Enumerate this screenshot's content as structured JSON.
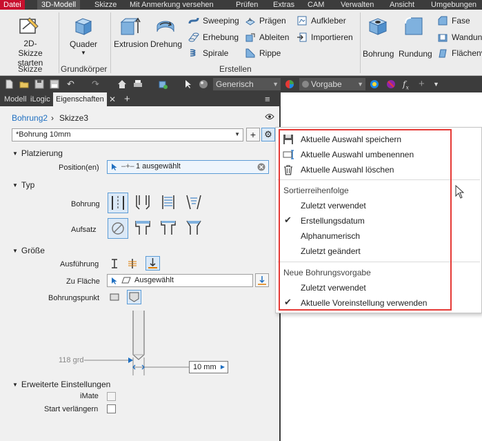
{
  "ribbon_tabs": [
    "Datei",
    "3D-Modell",
    "Skizze",
    "Mit Anmerkung versehen",
    "Prüfen",
    "Extras",
    "CAM",
    "Verwalten",
    "Ansicht",
    "Umgebungen"
  ],
  "ribbon": {
    "sketch_button": "2D-Skizze\nstarten",
    "sketch_group": "Skizze",
    "box_button": "Quader",
    "primitives_group": "Grundkörper",
    "extrude": "Extrusion",
    "revolve": "Drehung",
    "sweep": "Sweeping",
    "loft": "Erhebung",
    "coil": "Spirale",
    "emboss": "Prägen",
    "derive": "Ableiten",
    "rib": "Rippe",
    "decal": "Aufkleber",
    "import": "Importieren",
    "create_group": "Erstellen",
    "hole": "Bohrung",
    "fillet": "Rundung",
    "chamfer": "Fase",
    "shell": "Wandung",
    "face_draft": "Flächenv"
  },
  "qat": {
    "material": "Generisch",
    "appearance": "Vorgabe"
  },
  "panel": {
    "tabs": [
      "Modell",
      "iLogic",
      "Eigenschaften"
    ],
    "breadcrumb_feature": "Bohrung2",
    "breadcrumb_sketch": "Skizze3",
    "preset_value": "*Bohrung 10mm",
    "section_placement": "Platzierung",
    "positions_label": "Position(en)",
    "positions_value": "1 ausgewählt",
    "section_type": "Typ",
    "hole_label": "Bohrung",
    "seat_label": "Aufsatz",
    "section_size": "Größe",
    "termination_label": "Ausführung",
    "to_face_label": "Zu Fläche",
    "to_face_value": "Ausgewählt",
    "drill_point_label": "Bohrungspunkt",
    "angle_value": "118 grd",
    "diameter_value": "10 mm",
    "section_advanced": "Erweiterte Einstellungen",
    "imate_label": "iMate",
    "extend_start_label": "Start verlängern"
  },
  "menu": {
    "save_selection": "Aktuelle Auswahl speichern",
    "rename_selection": "Aktuelle Auswahl umbenennen",
    "delete_selection": "Aktuelle Auswahl löschen",
    "sort_heading": "Sortierreihenfolge",
    "sort_items": [
      "Zuletzt verwendet",
      "Erstellungsdatum",
      "Alphanumerisch",
      "Zuletzt geändert"
    ],
    "sort_checked_index": 1,
    "default_heading": "Neue Bohrungsvorgabe",
    "default_items": [
      "Zuletzt verwendet",
      "Aktuelle Voreinstellung verwenden"
    ],
    "default_checked_index": 1
  },
  "colors": {
    "file_tab": "#c8102e",
    "dark_bar": "#3c3c3c",
    "link_blue": "#1f6fc1",
    "highlight_red": "#e53935",
    "selected_fill": "#dbe9f7"
  }
}
